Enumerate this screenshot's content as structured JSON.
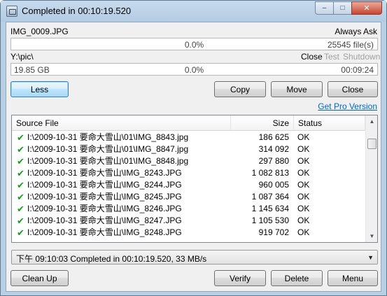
{
  "window": {
    "title": "Completed in 00:10:19.520",
    "controls": {
      "minimize": "‒",
      "maximize": "□",
      "close": "✕"
    }
  },
  "source": {
    "current_file": "IMG_0009.JPG",
    "mode": "Always Ask",
    "percent": "0.0%",
    "files": "25545 file(s)",
    "progress": 0.0
  },
  "dest": {
    "path": "Y:\\pic\\",
    "after_close": "Close",
    "after_test": "Test",
    "after_shutdown": "Shutdown",
    "size": "19.85 GB",
    "percent": "0.0%",
    "time": "00:09:24",
    "progress": 0.0
  },
  "buttons": {
    "less": "Less",
    "copy": "Copy",
    "move": "Move",
    "close": "Close",
    "clean_up": "Clean Up",
    "verify": "Verify",
    "delete": "Delete",
    "menu": "Menu"
  },
  "pro_link": "Get Pro Version",
  "list": {
    "columns": [
      "Source File",
      "Size",
      "Status"
    ],
    "rows": [
      {
        "file": "I:\\2009-10-31 要命大雪山\\01\\IMG_8843.jpg",
        "size": "186 625",
        "status": "OK"
      },
      {
        "file": "I:\\2009-10-31 要命大雪山\\01\\IMG_8847.jpg",
        "size": "314 092",
        "status": "OK"
      },
      {
        "file": "I:\\2009-10-31 要命大雪山\\01\\IMG_8848.jpg",
        "size": "297 880",
        "status": "OK"
      },
      {
        "file": "I:\\2009-10-31 要命大雪山\\IMG_8243.JPG",
        "size": "1 082 813",
        "status": "OK"
      },
      {
        "file": "I:\\2009-10-31 要命大雪山\\IMG_8244.JPG",
        "size": "960 005",
        "status": "OK"
      },
      {
        "file": "I:\\2009-10-31 要命大雪山\\IMG_8245.JPG",
        "size": "1 087 364",
        "status": "OK"
      },
      {
        "file": "I:\\2009-10-31 要命大雪山\\IMG_8246.JPG",
        "size": "1 145 634",
        "status": "OK"
      },
      {
        "file": "I:\\2009-10-31 要命大雪山\\IMG_8247.JPG",
        "size": "1 105 530",
        "status": "OK"
      },
      {
        "file": "I:\\2009-10-31 要命大雪山\\IMG_8248.JPG",
        "size": "919 702",
        "status": "OK"
      }
    ]
  },
  "status_combo": "下午 09:10:03 Completed in 00:10:19.520, 33 MB/s",
  "colors": {
    "ok_check": "#1b9a1b",
    "link": "#0066cc",
    "titlebar": "#b9cfe3"
  }
}
